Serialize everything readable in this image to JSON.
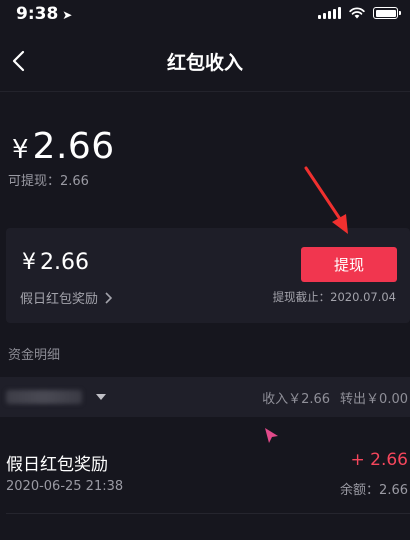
{
  "status_bar": {
    "time": "9:38"
  },
  "nav": {
    "title": "红包收入"
  },
  "balance": {
    "currency": "¥",
    "amount": "2.66",
    "available": "可提现：2.66"
  },
  "reward_card": {
    "currency": "¥",
    "amount": "2.66",
    "source_label": "假日红包奖励",
    "withdraw_label": "提现",
    "deadline": "提现截止：2020.07.04"
  },
  "details": {
    "section_title": "资金明细",
    "income": "收入￥2.66",
    "outgo": "转出￥0.00"
  },
  "transactions": [
    {
      "title": "假日红包奖励",
      "date": "2020-06-25 21:38",
      "amount": "+ 2.66",
      "balance": "余额：2.66"
    }
  ],
  "colors": {
    "background": "#16161e",
    "card": "#1e1e28",
    "accent": "#f1364f",
    "positive_amount": "#f5465c"
  }
}
